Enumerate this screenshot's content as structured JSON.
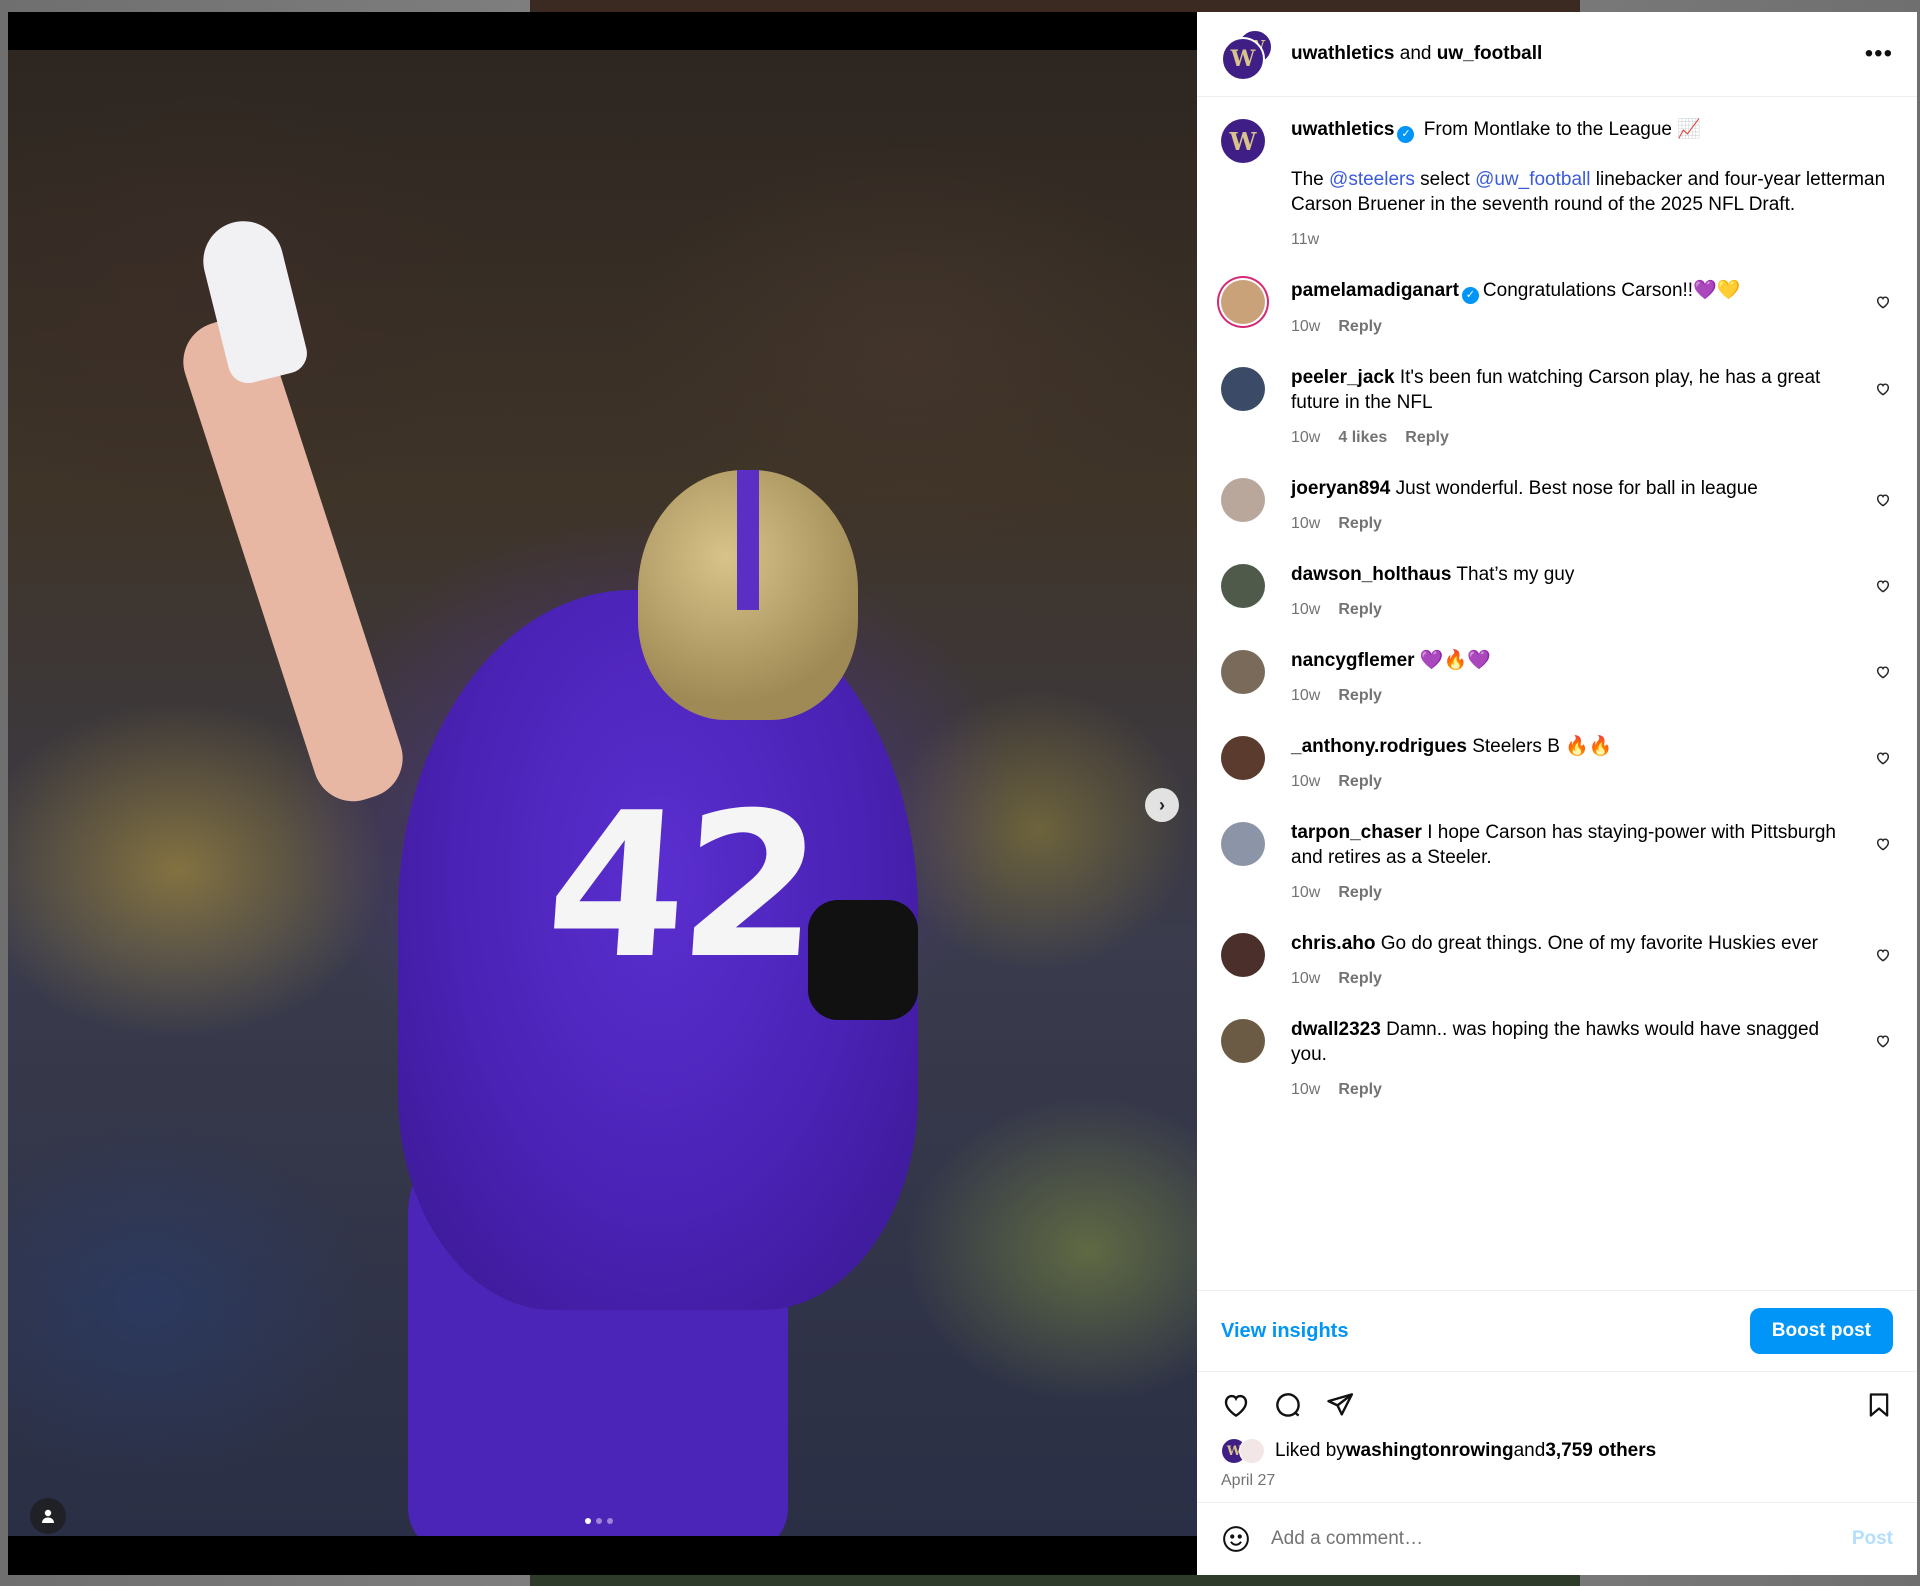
{
  "header": {
    "account1": "uwathletics",
    "joiner": "and",
    "account2": "uw_football",
    "more_icon": "more-horizontal-icon"
  },
  "media": {
    "jersey_number": "42",
    "carousel_index": 1,
    "carousel_count": 3
  },
  "caption": {
    "username": "uwathletics",
    "headline": "From Montlake to the League 📈",
    "text_parts": [
      "The ",
      "@steelers",
      " select ",
      "@uw_football",
      " linebacker and four-year letterman Carson Bruener in the seventh round of the 2025 NFL Draft."
    ],
    "time": "11w"
  },
  "comments": [
    {
      "username": "pamelamadiganart",
      "verified": true,
      "text": "Congratulations Carson!!💜💛",
      "time": "10w",
      "likes": "",
      "reply": "Reply",
      "avatar_color": "#c9a27a"
    },
    {
      "username": "peeler_jack",
      "verified": false,
      "text": "It's been fun watching Carson play, he has a great future in the NFL",
      "time": "10w",
      "likes": "4 likes",
      "reply": "Reply",
      "avatar_color": "#3b4a66"
    },
    {
      "username": "joeryan894",
      "verified": false,
      "text": "Just wonderful. Best nose for ball in league",
      "time": "10w",
      "likes": "",
      "reply": "Reply",
      "avatar_color": "#b9a79b"
    },
    {
      "username": "dawson_holthaus",
      "verified": false,
      "text": "That’s my guy",
      "time": "10w",
      "likes": "",
      "reply": "Reply",
      "avatar_color": "#4f5a4a"
    },
    {
      "username": "nancygflemer",
      "verified": false,
      "text": "💜🔥💜",
      "time": "10w",
      "likes": "",
      "reply": "Reply",
      "avatar_color": "#7a6a5a"
    },
    {
      "username": "_anthony.rodrigues",
      "verified": false,
      "text": "Steelers B 🔥🔥",
      "time": "10w",
      "likes": "",
      "reply": "Reply",
      "avatar_color": "#5a3b2e"
    },
    {
      "username": "tarpon_chaser",
      "verified": false,
      "text": "I hope Carson has staying-power with Pittsburgh and retires as a Steeler.",
      "time": "10w",
      "likes": "",
      "reply": "Reply",
      "avatar_color": "#8c94a8"
    },
    {
      "username": "chris.aho",
      "verified": false,
      "text": "Go do great things. One of my favorite Huskies ever",
      "time": "10w",
      "likes": "",
      "reply": "Reply",
      "avatar_color": "#4a2f2a"
    },
    {
      "username": "dwall2323",
      "verified": false,
      "text": "Damn.. was hoping the hawks would have snagged you.",
      "time": "10w",
      "likes": "",
      "reply": "Reply",
      "avatar_color": "#6b5a44"
    }
  ],
  "insights": {
    "view_label": "View insights",
    "boost_label": "Boost post"
  },
  "actions": {
    "liked_prefix": "Liked by ",
    "liked_user": "washingtonrowing",
    "liked_mid": " and ",
    "liked_count": "3,759 others",
    "date": "April 27"
  },
  "add_comment": {
    "placeholder": "Add a comment…",
    "post_label": "Post"
  },
  "colors": {
    "accent": "#0095f6",
    "uw_purple": "#3f1f86",
    "uw_gold": "#d8c38a"
  }
}
